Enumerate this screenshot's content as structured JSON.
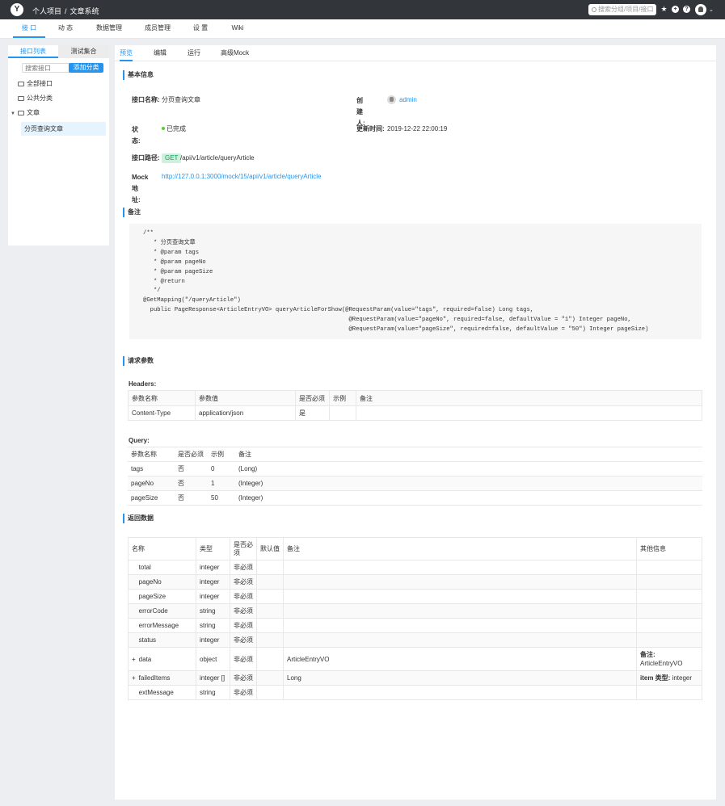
{
  "topbar": {
    "project": "个人项目",
    "separator": "/",
    "system": "文章系统",
    "search_placeholder": "搜索分组/项目/接口",
    "star_icon": "★",
    "plus_icon": "+",
    "help_icon": "?",
    "dropdown_icon": "⌄"
  },
  "mainnav": [
    "接 口",
    "动 态",
    "数据管理",
    "成员管理",
    "设 置",
    "Wiki"
  ],
  "leftpanel": {
    "tabs": [
      "接口列表",
      "测试集合"
    ],
    "search_placeholder": "搜索接口",
    "add_button": "添加分类",
    "items": [
      "全部接口",
      "公共分类",
      "文章"
    ],
    "selected_item": "分页查询文章"
  },
  "rightpanel": {
    "tabs": [
      "预览",
      "编辑",
      "运行",
      "高级Mock"
    ],
    "basic": {
      "section_title": "基本信息",
      "name_label": "接口名称:",
      "name_value": "分页查询文章",
      "creator_label": "创 建\n人:",
      "creator_value": "admin",
      "status_label": "状\n态:",
      "status_value": "已完成",
      "updated_label": "更新时间:",
      "updated_value": "2019-12-22 22:00:19",
      "path_label": "接口路径:",
      "method": "GET",
      "path_value": "/api/v1/article/queryArticle",
      "mock_label": "Mock地\n址:",
      "mock_value": "http://127.0.0.1:3000/mock/15/api/v1/article/queryArticle"
    },
    "remark": {
      "section_title": "备注",
      "code": "/**\n   * 分页查询文章\n   * @param tags\n   * @param pageNo\n   * @param pageSize\n   * @return\n   */\n@GetMapping(\"/queryArticle\")\n  public PageResponse<ArticleEntryVO> queryArticleForShow(@RequestParam(value=\"tags\", required=false) Long tags,\n                                                           @RequestParam(value=\"pageNo\", required=false, defaultValue = \"1\") Integer pageNo,\n                                                           @RequestParam(value=\"pageSize\", required=false, defaultValue = \"50\") Integer pageSize)"
    },
    "request": {
      "section_title": "请求参数",
      "headers_label": "Headers:",
      "headers_columns": [
        "参数名称",
        "参数值",
        "是否必须",
        "示例",
        "备注"
      ],
      "headers_rows": [
        [
          "Content-Type",
          "application/json",
          "是",
          "",
          ""
        ]
      ],
      "query_label": "Query:",
      "query_columns": [
        "参数名称",
        "是否必须",
        "示例",
        "备注"
      ],
      "query_rows": [
        [
          "tags",
          "否",
          "0",
          "(Long)"
        ],
        [
          "pageNo",
          "否",
          "1",
          "(Integer)"
        ],
        [
          "pageSize",
          "否",
          "50",
          "(Integer)"
        ]
      ]
    },
    "response": {
      "section_title": "返回数据",
      "columns": [
        "名称",
        "类型",
        "是否必须",
        "默认值",
        "备注",
        "其他信息"
      ],
      "rows": [
        {
          "expand": "",
          "name": "total",
          "type": "integer",
          "required": "非必须",
          "default": "",
          "remark": "",
          "other_key": "",
          "other_val": ""
        },
        {
          "expand": "",
          "name": "pageNo",
          "type": "integer",
          "required": "非必须",
          "default": "",
          "remark": "",
          "other_key": "",
          "other_val": ""
        },
        {
          "expand": "",
          "name": "pageSize",
          "type": "integer",
          "required": "非必须",
          "default": "",
          "remark": "",
          "other_key": "",
          "other_val": ""
        },
        {
          "expand": "",
          "name": "errorCode",
          "type": "string",
          "required": "非必须",
          "default": "",
          "remark": "",
          "other_key": "",
          "other_val": ""
        },
        {
          "expand": "",
          "name": "errorMessage",
          "type": "string",
          "required": "非必须",
          "default": "",
          "remark": "",
          "other_key": "",
          "other_val": ""
        },
        {
          "expand": "",
          "name": "status",
          "type": "integer",
          "required": "非必须",
          "default": "",
          "remark": "",
          "other_key": "",
          "other_val": ""
        },
        {
          "expand": "+",
          "name": "data",
          "type": "object",
          "required": "非必须",
          "default": "",
          "remark": "ArticleEntryVO",
          "other_key": "备注:",
          "other_val": "ArticleEntryVO"
        },
        {
          "expand": "+",
          "name": "failedItems",
          "type": "integer []",
          "required": "非必须",
          "default": "",
          "remark": "Long",
          "other_key": "item 类型:",
          "other_val": "integer"
        },
        {
          "expand": "",
          "name": "extMessage",
          "type": "string",
          "required": "非必须",
          "default": "",
          "remark": "",
          "other_key": "",
          "other_val": ""
        }
      ]
    }
  }
}
